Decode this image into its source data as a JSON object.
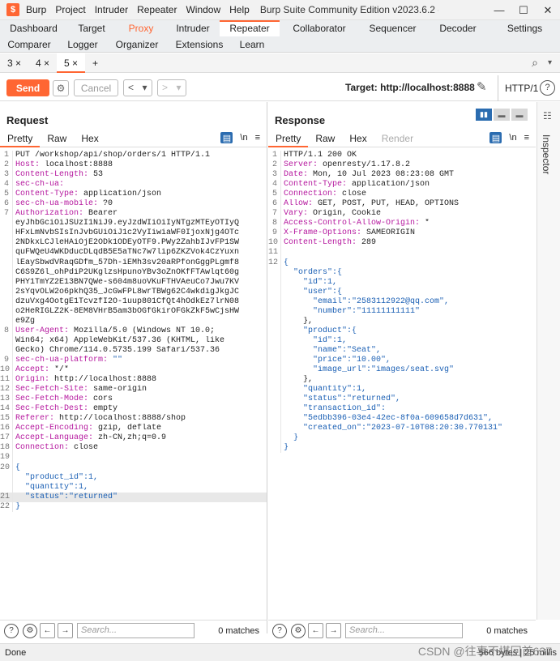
{
  "titlebar": {
    "menu": [
      "Burp",
      "Project",
      "Intruder",
      "Repeater",
      "Window",
      "Help"
    ],
    "title": "Burp Suite Community Edition v2023.6.2 - Temporar..."
  },
  "tabs_row1": [
    "Dashboard",
    "Target",
    "Proxy",
    "Intruder",
    "Repeater",
    "Collaborator",
    "Sequencer",
    "Decoder",
    "Settings"
  ],
  "tabs_row2": [
    "Comparer",
    "Logger",
    "Organizer",
    "Extensions",
    "Learn"
  ],
  "repeater_tabs": [
    "3 ×",
    "4 ×",
    "5 ×",
    "+"
  ],
  "toolbar": {
    "send_label": "Send",
    "cancel_label": "Cancel",
    "target_label": "Target: http://localhost:8888",
    "http_version": "HTTP/1"
  },
  "request": {
    "title": "Request",
    "tabs": [
      "Pretty",
      "Raw",
      "Hex"
    ],
    "newline_toggle": "\\n",
    "lines": [
      [
        "",
        "PUT /workshop/api/shop/orders/1 HTTP/1.1"
      ],
      [
        "Host:",
        " localhost:8888"
      ],
      [
        "Content-Length:",
        " 53"
      ],
      [
        "sec-ch-ua:",
        ""
      ],
      [
        "Content-Type:",
        " application/json"
      ],
      [
        "sec-ch-ua-mobile:",
        " ?0"
      ],
      [
        "Authorization:",
        " Bearer"
      ],
      [
        "",
        "eyJhbGciOiJSUzI1NiJ9.eyJzdWIiOiIyNTgzMTEyOTIyQ"
      ],
      [
        "",
        "HFxLmNvbSIsInJvbGUiOiJ1c2VyIiwiaWF0IjoxNjg4OTc"
      ],
      [
        "",
        "2NDkxLCJleHAiOjE2ODk1ODEyOTF9.PWy2ZahbIJvFP1SW"
      ],
      [
        "",
        "quFWQeU4WKDducDLqdB5E5aTNc7w7lip6ZKZVok4CzYuxn"
      ],
      [
        "",
        "lEaySbwdVRaqGDfm_57Dh-iEMh3sv20aRPfonGggPLgmf8"
      ],
      [
        "",
        "C6S9Z6l_ohPdiP2UKglzsHpunoYBv3oZnOKfFTAwlqt60g"
      ],
      [
        "",
        "PHY1TmYZ2E13BN7QWe-s604m8uoVKuFTHVAeuCo7Jwu7KV"
      ],
      [
        "",
        "2sYqvOLW2o6pkhQ35_JcGwFPL8wrTBWg62C4wkdigJkgJC"
      ],
      [
        "",
        "dzuVxg4OotgE1TcvzfI2O-1uup801CfQt4hOdkEz7lrN08"
      ],
      [
        "",
        "o2HeRIGLZ2K-8EM8VHrB5am3bOGfGkirOFGkZkF5wCjsHW"
      ],
      [
        "",
        "e9Zg"
      ],
      [
        "User-Agent:",
        " Mozilla/5.0 (Windows NT 10.0;"
      ],
      [
        "",
        "Win64; x64) AppleWebKit/537.36 (KHTML, like"
      ],
      [
        "",
        "Gecko) Chrome/114.0.5735.199 Safari/537.36"
      ],
      [
        "sec-ch-ua-platform:",
        " \"\""
      ],
      [
        "Accept:",
        " */*"
      ],
      [
        "Origin:",
        " http://localhost:8888"
      ],
      [
        "Sec-Fetch-Site:",
        " same-origin"
      ],
      [
        "Sec-Fetch-Mode:",
        " cors"
      ],
      [
        "Sec-Fetch-Dest:",
        " empty"
      ],
      [
        "Referer:",
        " http://localhost:8888/shop"
      ],
      [
        "Accept-Encoding:",
        " gzip, deflate"
      ],
      [
        "Accept-Language:",
        " zh-CN,zh;q=0.9"
      ],
      [
        "Connection:",
        " close"
      ],
      [
        "",
        ""
      ],
      [
        "",
        "{"
      ],
      [
        "",
        "  \"product_id\":1,"
      ],
      [
        "",
        "  \"quantity\":1,"
      ],
      [
        "",
        "  \"status\":\"returned\""
      ],
      [
        "",
        "}"
      ]
    ],
    "line_numbers": [
      "1",
      "2",
      "3",
      "4",
      "5",
      "6",
      "7",
      "",
      "",
      "",
      "",
      "",
      "",
      "",
      "",
      "",
      "",
      "",
      "8",
      "",
      "",
      "9",
      "10",
      "11",
      "12",
      "13",
      "14",
      "15",
      "16",
      "17",
      "18",
      "19",
      "20",
      "",
      "",
      "21",
      "22"
    ]
  },
  "response": {
    "title": "Response",
    "tabs": [
      "Pretty",
      "Raw",
      "Hex",
      "Render"
    ],
    "newline_toggle": "\\n",
    "lines": [
      [
        "",
        "HTTP/1.1 200 OK"
      ],
      [
        "Server:",
        " openresty/1.17.8.2"
      ],
      [
        "Date:",
        " Mon, 10 Jul 2023 08:23:08 GMT"
      ],
      [
        "Content-Type:",
        " application/json"
      ],
      [
        "Connection:",
        " close"
      ],
      [
        "Allow:",
        " GET, POST, PUT, HEAD, OPTIONS"
      ],
      [
        "Vary:",
        " Origin, Cookie"
      ],
      [
        "Access-Control-Allow-Origin:",
        " *"
      ],
      [
        "X-Frame-Options:",
        " SAMEORIGIN"
      ],
      [
        "Content-Length:",
        " 289"
      ],
      [
        "",
        ""
      ],
      [
        "",
        "{"
      ],
      [
        "",
        "  \"orders\":{"
      ],
      [
        "",
        "    \"id\":1,"
      ],
      [
        "",
        "    \"user\":{"
      ],
      [
        "",
        "      \"email\":\"2583112922@qq.com\","
      ],
      [
        "",
        "      \"number\":\"11111111111\""
      ],
      [
        "",
        "    },"
      ],
      [
        "",
        "    \"product\":{"
      ],
      [
        "",
        "      \"id\":1,"
      ],
      [
        "",
        "      \"name\":\"Seat\","
      ],
      [
        "",
        "      \"price\":\"10.00\","
      ],
      [
        "",
        "      \"image_url\":\"images/seat.svg\""
      ],
      [
        "",
        "    },"
      ],
      [
        "",
        "    \"quantity\":1,"
      ],
      [
        "",
        "    \"status\":\"returned\","
      ],
      [
        "",
        "    \"transaction_id\":"
      ],
      [
        "",
        "    \"5edbb396-03e4-42ec-8f0a-609658d7d631\","
      ],
      [
        "",
        "    \"created_on\":\"2023-07-10T08:20:30.770131\""
      ],
      [
        "",
        "  }"
      ],
      [
        "",
        "}"
      ]
    ],
    "line_numbers": [
      "1",
      "2",
      "3",
      "4",
      "5",
      "6",
      "7",
      "8",
      "9",
      "10",
      "11",
      "12",
      "",
      "",
      "",
      "",
      "",
      "",
      "",
      "",
      "",
      "",
      "",
      "",
      "",
      "",
      "",
      "",
      "",
      "",
      ""
    ]
  },
  "search": {
    "placeholder": "Search...",
    "matches_label": "0 matches"
  },
  "inspector_label": "Inspector",
  "status": {
    "done": "Done",
    "info": "566 bytes | 25 millis"
  },
  "watermark": "CSDN @往事不堪回首637"
}
